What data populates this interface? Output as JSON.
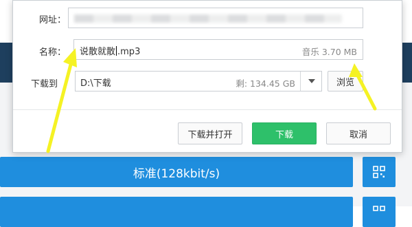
{
  "dialog": {
    "url_label": "网址：",
    "name_label": "名称：",
    "name_value_before_caret": "说散就散",
    "name_value_after_caret": ".mp3",
    "file_type": "音乐",
    "file_size": "3.70 MB",
    "save_label": "下载到",
    "save_path": "D:\\下载",
    "free_space_label": "剩:",
    "free_space_value": "134.45 GB",
    "browse_label": "浏览",
    "download_and_open_label": "下载并打开",
    "download_label": "下载",
    "cancel_label": "取消"
  },
  "background": {
    "quality_standard_label": "标准(128kbit/s)"
  },
  "colors": {
    "primary_green": "#2ec06a",
    "quality_blue": "#1f8ede",
    "annotation_yellow": "#f5f224"
  },
  "icons": {
    "dropdown": "chevron-down-icon",
    "qr": "qr-code-icon",
    "annotation": "arrow-annotation-icon"
  }
}
